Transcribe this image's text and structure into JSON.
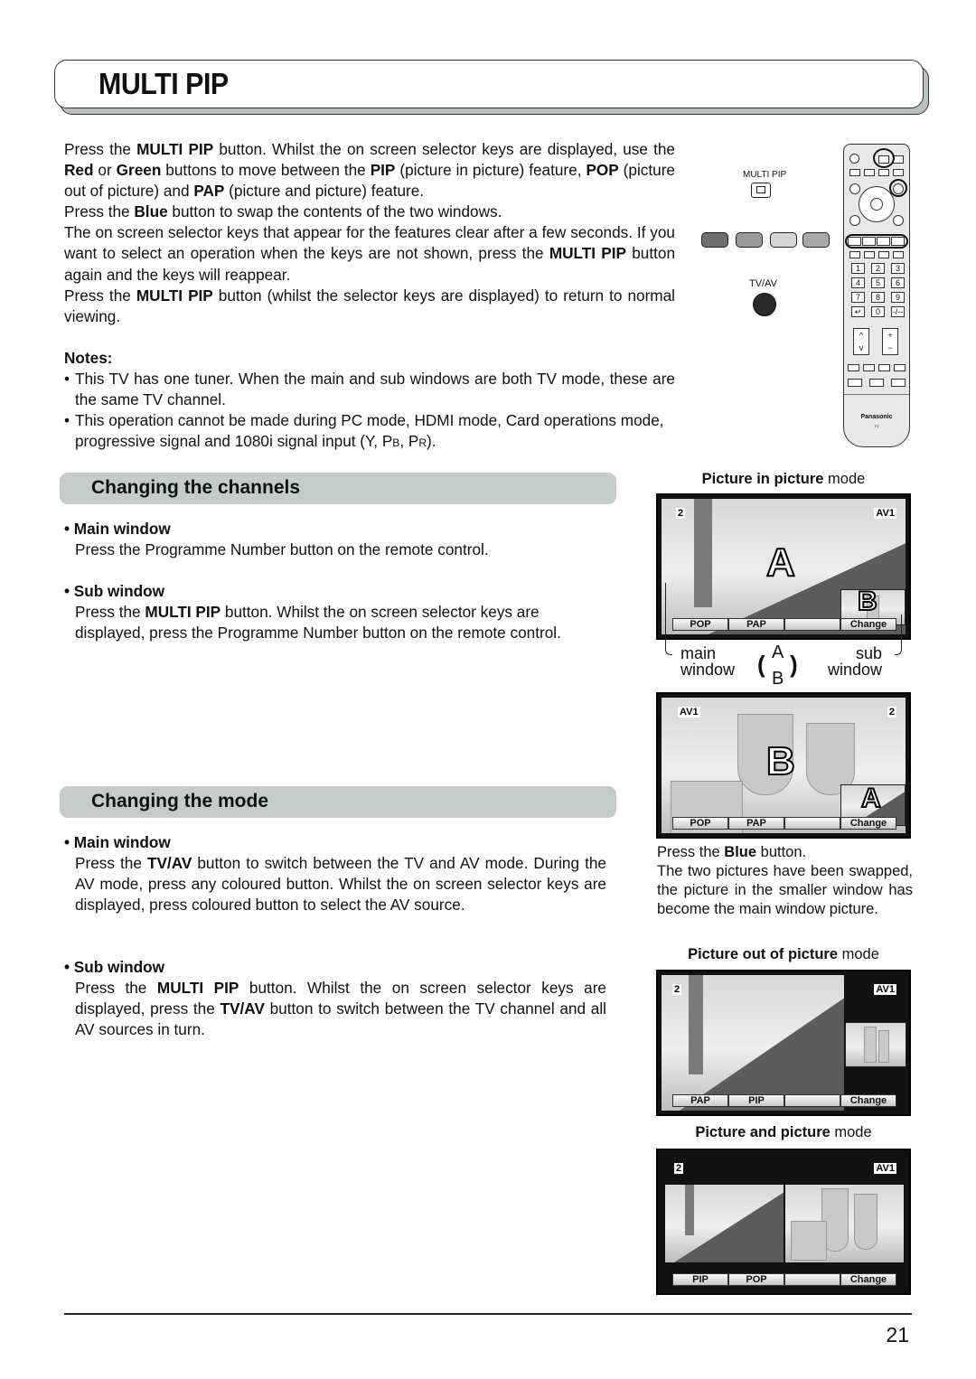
{
  "title": "MULTI PIP",
  "intro": [
    [
      {
        "t": "Press the "
      },
      {
        "t": "MULTI PIP",
        "b": true
      },
      {
        "t": " button. Whilst the on screen selector keys are displayed, use the "
      },
      {
        "t": "Red",
        "b": true
      },
      {
        "t": " or "
      },
      {
        "t": "Green",
        "b": true
      },
      {
        "t": " buttons to move between the "
      },
      {
        "t": "PIP",
        "b": true
      },
      {
        "t": " (picture in picture) feature, "
      },
      {
        "t": "POP",
        "b": true
      },
      {
        "t": " (picture out of picture) and "
      },
      {
        "t": "PAP",
        "b": true
      },
      {
        "t": " (picture and picture) feature."
      }
    ],
    [
      {
        "t": "Press the "
      },
      {
        "t": "Blue",
        "b": true
      },
      {
        "t": " button to swap the contents of the two windows."
      }
    ],
    [
      {
        "t": "The on screen selector keys that appear for the features clear after a few seconds. If you want to select an operation when the keys are not shown, press the "
      },
      {
        "t": "MULTI PIP",
        "b": true
      },
      {
        "t": " button again and the keys will reappear."
      }
    ],
    [
      {
        "t": "Press the "
      },
      {
        "t": "MULTI PIP",
        "b": true
      },
      {
        "t": " button (whilst the selector keys are displayed) to return to normal viewing."
      }
    ]
  ],
  "notes": {
    "heading": "Notes:",
    "items": [
      "This TV has one tuner. When the main and sub windows are both TV mode, these are the same TV channel.",
      "This operation cannot be made during PC mode, HDMI mode, Card operations mode, progressive signal and 1080i signal input (Y, PB, PR)."
    ]
  },
  "sections": {
    "channels": {
      "heading": "Changing the channels",
      "main_head": "Main window",
      "main_body": [
        {
          "t": "Press the Programme Number button on the remote control."
        }
      ],
      "sub_head": "Sub window",
      "sub_body": [
        {
          "t": "Press the "
        },
        {
          "t": "MULTI PIP",
          "b": true
        },
        {
          "t": " button. Whilst the on screen selector keys are displayed, press the Programme Number button on the remote control."
        }
      ]
    },
    "mode": {
      "heading": "Changing the mode",
      "main_head": "Main window",
      "main_body": [
        {
          "t": "Press the "
        },
        {
          "t": "TV/AV",
          "b": true
        },
        {
          "t": " button to switch between the TV and AV mode. During the AV mode, press any coloured button. Whilst the on screen selector keys are displayed, press coloured button to select the AV source."
        }
      ],
      "sub_head": "Sub window",
      "sub_body": [
        {
          "t": "Press the "
        },
        {
          "t": "MULTI PIP",
          "b": true
        },
        {
          "t": " button. Whilst the on screen selector keys are displayed, press the "
        },
        {
          "t": "TV/AV",
          "b": true
        },
        {
          "t": " button to switch between the TV channel and all AV sources in turn."
        }
      ]
    }
  },
  "remote": {
    "multi_pip_label": "MULTI PIP",
    "tvav_label": "TV/AV",
    "color_buttons": [
      "#6e6e6e",
      "#9a9a9a",
      "#d6d6d6",
      "#a9a9a9"
    ],
    "numpad": [
      "1",
      "2",
      "3",
      "4",
      "5",
      "6",
      "7",
      "8",
      "9",
      "↵",
      "0",
      "-/--"
    ],
    "brand": "Panasonic",
    "brand_sub": "TV"
  },
  "figures": {
    "pip": {
      "caption_bold": "Picture in picture",
      "caption_rest": " mode",
      "left_tag": "2",
      "right_tag": "AV1",
      "main_letter": "A",
      "sub_letter": "B",
      "buttons": [
        "POP",
        "PAP",
        "",
        "Change"
      ]
    },
    "swap_labels": {
      "main": "main",
      "main2": "window",
      "sub": "sub",
      "sub2": "window",
      "a": "A",
      "b": "B"
    },
    "swapped": {
      "left_tag": "AV1",
      "right_tag": "2",
      "main_letter": "B",
      "sub_letter": "A",
      "buttons": [
        "POP",
        "PAP",
        "",
        "Change"
      ]
    },
    "blue_caption": [
      {
        "t": "Press the "
      },
      {
        "t": "Blue",
        "b": true
      },
      {
        "t": " button."
      }
    ],
    "blue_caption_2": "The two pictures have been swapped, the picture in the smaller window has become the main window picture.",
    "pop": {
      "caption_bold": "Picture out of picture",
      "caption_rest": " mode",
      "left_tag": "2",
      "right_tag": "AV1",
      "buttons": [
        "PAP",
        "PIP",
        "",
        "Change"
      ]
    },
    "pap": {
      "caption_bold": "Picture and picture",
      "caption_rest": " mode",
      "left_tag": "2",
      "right_tag": "AV1",
      "buttons": [
        "PIP",
        "POP",
        "",
        "Change"
      ]
    }
  },
  "page_number": "21"
}
